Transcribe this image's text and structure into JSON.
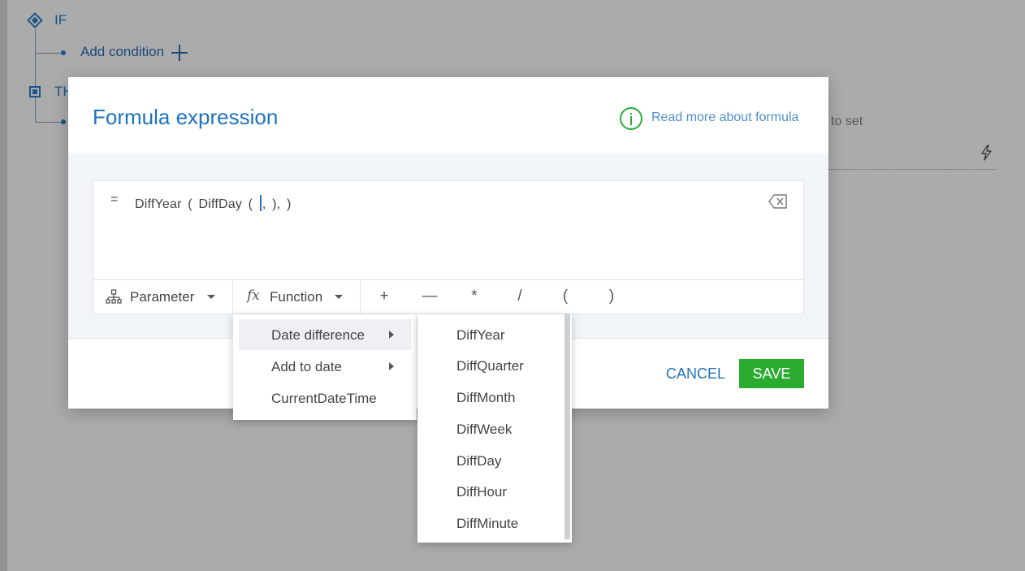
{
  "background": {
    "if_label": "IF",
    "add_condition_label": "Add condition",
    "then_label": "TH",
    "to_set_text": "to set"
  },
  "modal": {
    "title": "Formula expression",
    "read_more_link": "Read more about formula",
    "formula": {
      "equals_sign": "=",
      "expression_before_caret": "DiffYear ( DiffDay ( ",
      "expression_after_caret": ", ), )"
    },
    "toolbar": {
      "parameter_label": "Parameter",
      "function_label": "Function",
      "fx_glyph": "fx",
      "operators": [
        "+",
        "—",
        "*",
        "/",
        "(",
        ")"
      ]
    },
    "footer": {
      "cancel_label": "CANCEL",
      "save_label": "SAVE"
    }
  },
  "function_menu": {
    "items": [
      {
        "label": "Date difference",
        "has_submenu": true,
        "active": true
      },
      {
        "label": "Add to date",
        "has_submenu": true,
        "active": false
      },
      {
        "label": "CurrentDateTime",
        "has_submenu": false,
        "active": false
      }
    ]
  },
  "date_difference_submenu": {
    "items": [
      "DiffYear",
      "DiffQuarter",
      "DiffMonth",
      "DiffWeek",
      "DiffDay",
      "DiffHour",
      "DiffMinute"
    ]
  },
  "colors": {
    "accent_blue": "#1f73bd",
    "save_green": "#2aab2e",
    "info_green": "#2aaa3a"
  }
}
